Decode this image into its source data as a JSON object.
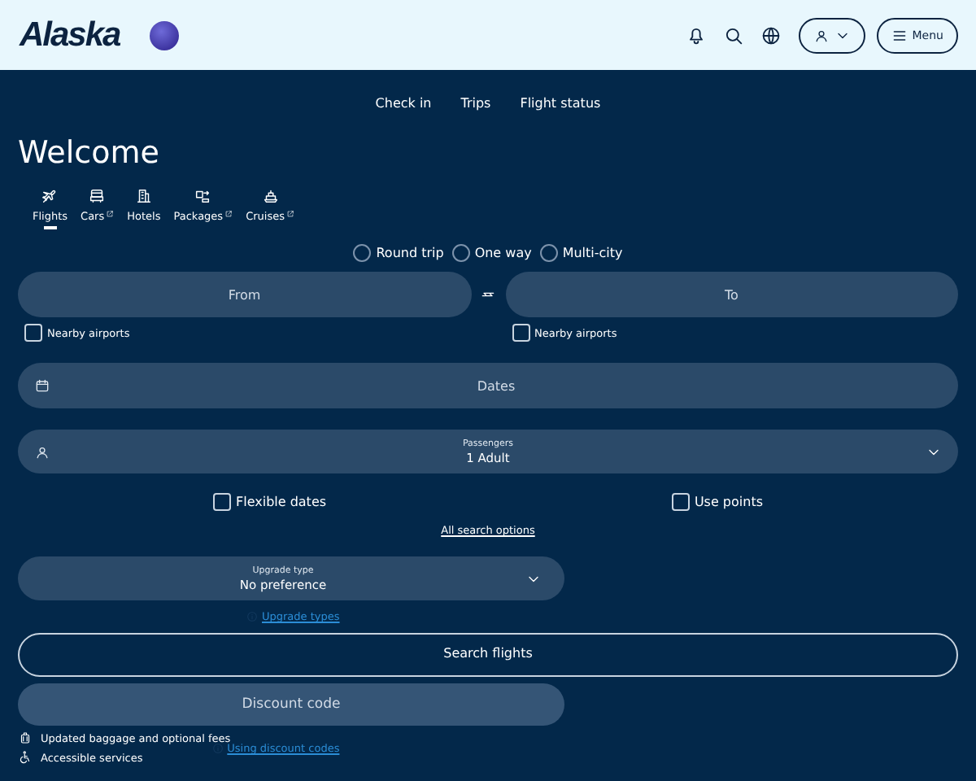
{
  "header": {
    "logo": "Alaska",
    "actions": [
      {
        "kind": "bell"
      },
      {
        "kind": "search"
      },
      {
        "kind": "globe"
      },
      {
        "kind": "account"
      },
      {
        "kind": "menu",
        "label": "Menu"
      }
    ]
  },
  "nav": [
    "Check in",
    "Trips",
    "Flight status"
  ],
  "title": "Welcome",
  "tabs": [
    {
      "label": "Flights",
      "kind": "plane",
      "external": false,
      "selected": true
    },
    {
      "label": "Cars",
      "kind": "car",
      "external": true,
      "selected": false
    },
    {
      "label": "Hotels",
      "kind": "hotel",
      "external": false,
      "selected": false
    },
    {
      "label": "Packages",
      "kind": "package",
      "external": true,
      "selected": false
    },
    {
      "label": "Cruises",
      "kind": "ship",
      "external": true,
      "selected": false
    }
  ],
  "trip_types": [
    {
      "label": "Round trip",
      "selected": false
    },
    {
      "label": "One way",
      "selected": false
    },
    {
      "label": "Multi-city",
      "selected": false
    }
  ],
  "from": {
    "placeholder": "From",
    "nearby": {
      "label": "Nearby airports",
      "checked": false
    }
  },
  "to": {
    "placeholder": "To",
    "nearby": {
      "label": "Nearby airports",
      "checked": false
    }
  },
  "dates": {
    "placeholder": "Dates"
  },
  "passengers": {
    "label": "Passengers",
    "value": "1 Adult"
  },
  "options": [
    {
      "label": "Flexible dates",
      "checked": false
    },
    {
      "label": "Use points",
      "checked": false
    }
  ],
  "all_options_link": "All search options",
  "upgrade": {
    "label": "Upgrade type",
    "value": "No preference",
    "help": "Upgrade types"
  },
  "search_button": "Search flights",
  "discount": {
    "placeholder": "Discount code",
    "help": "Using discount codes"
  },
  "footer_links": [
    {
      "kind": "luggage",
      "label": "Updated baggage and optional fees"
    },
    {
      "kind": "wheelchair",
      "label": "Accessible services"
    }
  ]
}
